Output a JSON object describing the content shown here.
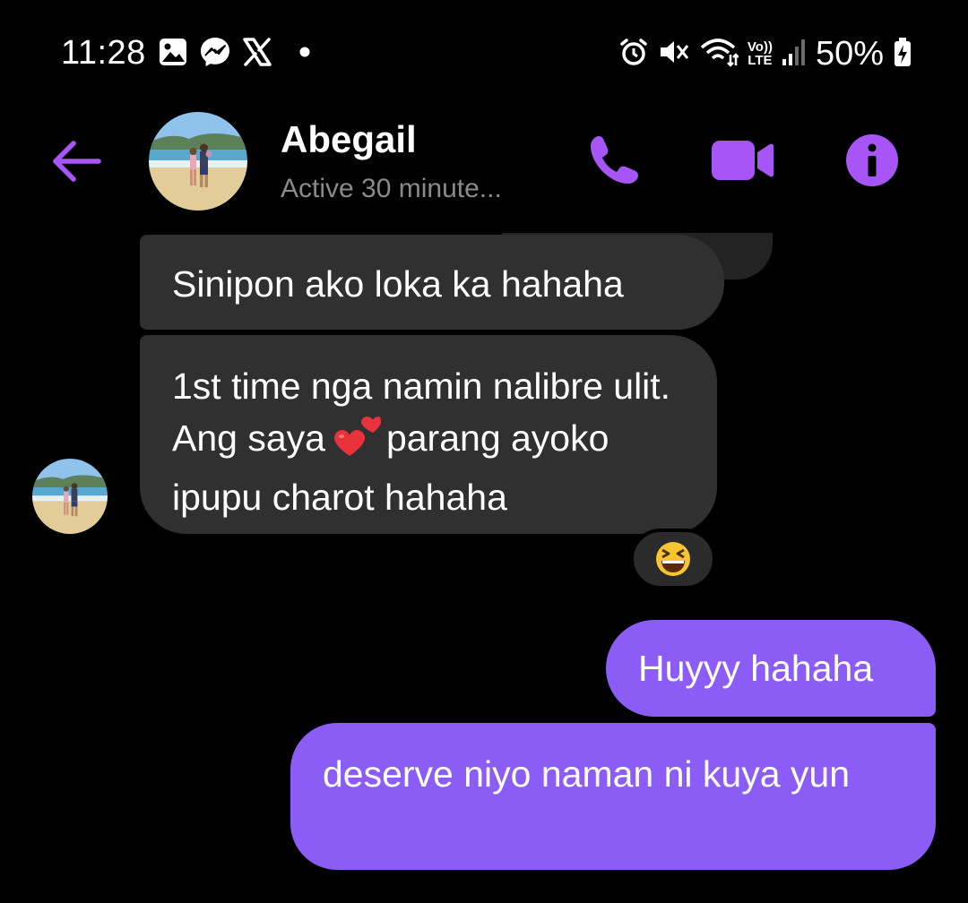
{
  "status_bar": {
    "time": "11:28",
    "left_icons": [
      "gallery-icon",
      "messenger-icon",
      "x-icon",
      "dot-icon"
    ],
    "vo_label": "Vo))",
    "lte_label": "LTE",
    "battery_percent": "50%"
  },
  "header": {
    "contact_name": "Abegail",
    "contact_status": "Active 30 minute...",
    "accent_color": "#a855f7"
  },
  "messages": [
    {
      "direction": "incoming",
      "text": "Sinipon ako loka ka hahaha"
    },
    {
      "direction": "incoming",
      "text_before": "1st time nga namin nalibre ulit. Ang saya",
      "inline_emoji": "two-hearts-emoji",
      "text_after": "parang ayoko ipupu charot hahaha",
      "reaction": "grinning-squinting-face-emoji"
    },
    {
      "direction": "outgoing",
      "text": "Huyyy hahaha"
    },
    {
      "direction": "outgoing",
      "text": "deserve niyo naman ni kuya yun"
    }
  ],
  "colors": {
    "background": "#000000",
    "incoming_bubble": "#303030",
    "outgoing_bubble": "#8b5cf6",
    "secondary_text": "#8a8a8a"
  }
}
